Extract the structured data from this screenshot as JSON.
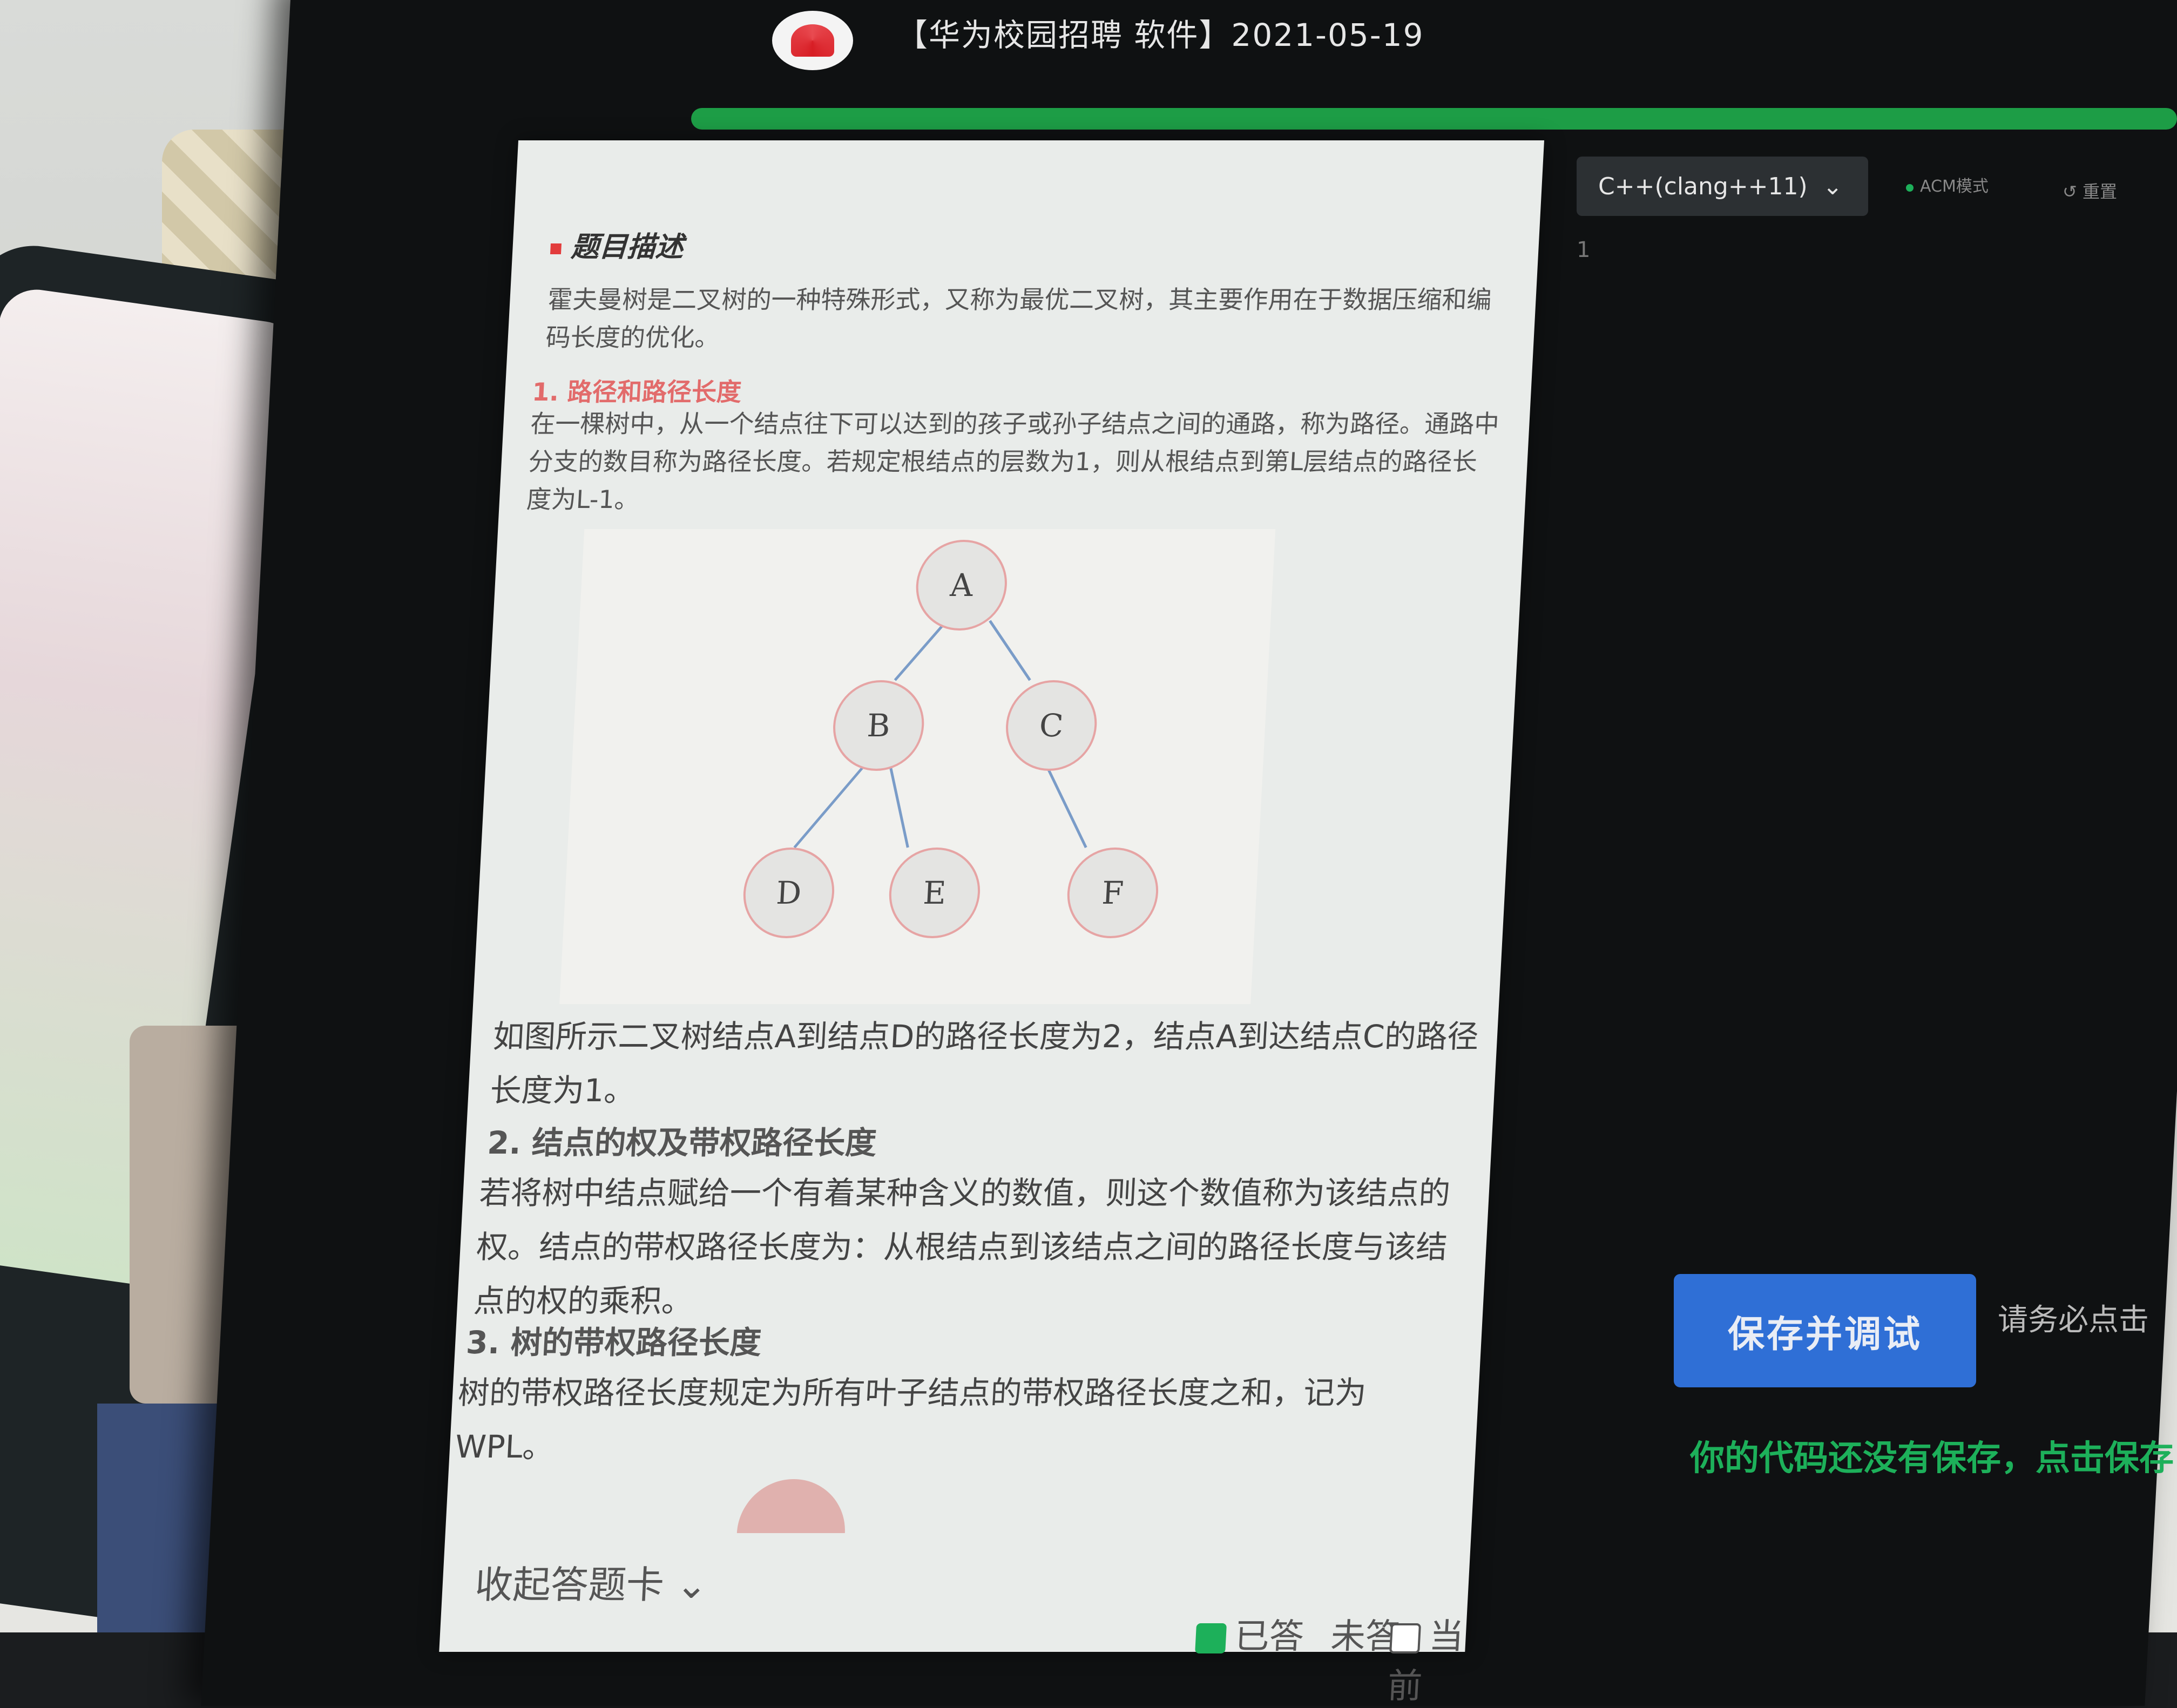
{
  "header": {
    "title": "【华为校园招聘 软件】2021-05-19",
    "progress_fraction": 1.0
  },
  "problem": {
    "section_title": "题目描述",
    "intro": "霍夫曼树是二叉树的一种特殊形式，又称为最优二叉树，其主要作用在于数据压缩和编码长度的优化。",
    "h1": "1. 路径和路径长度",
    "p1": "在一棵树中，从一个结点往下可以达到的孩子或孙子结点之间的通路，称为路径。通路中分支的数目称为路径长度。若规定根结点的层数为1，则从根结点到第L层结点的路径长度为L-1。",
    "tree_nodes": [
      "A",
      "B",
      "C",
      "D",
      "E",
      "F"
    ],
    "p2": "如图所示二叉树结点A到结点D的路径长度为2，结点A到达结点C的路径长度为1。",
    "h2": "2. 结点的权及带权路径长度",
    "p3": "若将树中结点赋给一个有着某种含义的数值，则这个数值称为该结点的权。结点的带权路径长度为：从根结点到该结点之间的路径长度与该结点的权的乘积。",
    "h3": "3. 树的带权路径长度",
    "p4": "树的带权路径长度规定为所有叶子结点的带权路径长度之和，记为WPL。"
  },
  "answer_card": {
    "collapse_label": "收起答题卡",
    "legend_answered": "已答",
    "legend_unanswered": "未答",
    "legend_current": "当前",
    "colors": {
      "answered": "#1db05a",
      "current": "#ffffff"
    }
  },
  "editor": {
    "language": "C++(clang++11)",
    "mode_label": "ACM模式",
    "reset_label": "重置",
    "line_number": "1",
    "save_button": "保存并调试",
    "hint_text": "请务必点击",
    "unsaved_warning": "你的代码还没有保存，点击保存",
    "colors": {
      "accent": "#2f6fd6",
      "success": "#1db05a"
    }
  }
}
